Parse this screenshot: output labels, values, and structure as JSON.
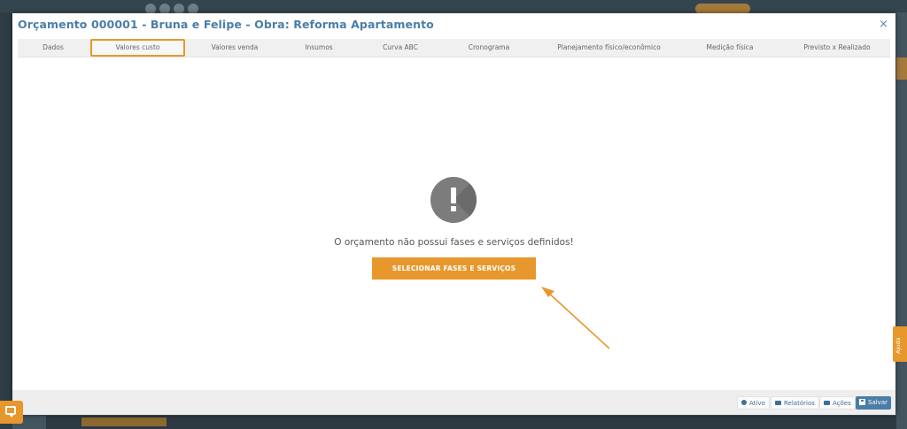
{
  "modal": {
    "title": "Orçamento 000001 - Bruna e Felipe - Obra: Reforma Apartamento",
    "close_label": "×"
  },
  "tabs": [
    {
      "label": "Dados"
    },
    {
      "label": "Valores custo",
      "active": true
    },
    {
      "label": "Valores venda"
    },
    {
      "label": "Insumos"
    },
    {
      "label": "Curva ABC"
    },
    {
      "label": "Cronograma"
    },
    {
      "label": "Planejamento físico/econômico"
    },
    {
      "label": "Medição física"
    },
    {
      "label": "Previsto x Realizado"
    }
  ],
  "content": {
    "alert_icon": "exclamation-icon",
    "message": "O orçamento não possui fases e serviços definidos!",
    "select_button": "SELECIONAR FASES E SERVIÇOS"
  },
  "footer": {
    "status_label": "Ativo",
    "reports_label": "Relatórios",
    "actions_label": "Ações",
    "save_label": "Salvar"
  },
  "side": {
    "help_label": "Ajuda"
  },
  "colors": {
    "accent": "#e8972d",
    "primary": "#4a7ea8",
    "title": "#4a7ea8"
  }
}
